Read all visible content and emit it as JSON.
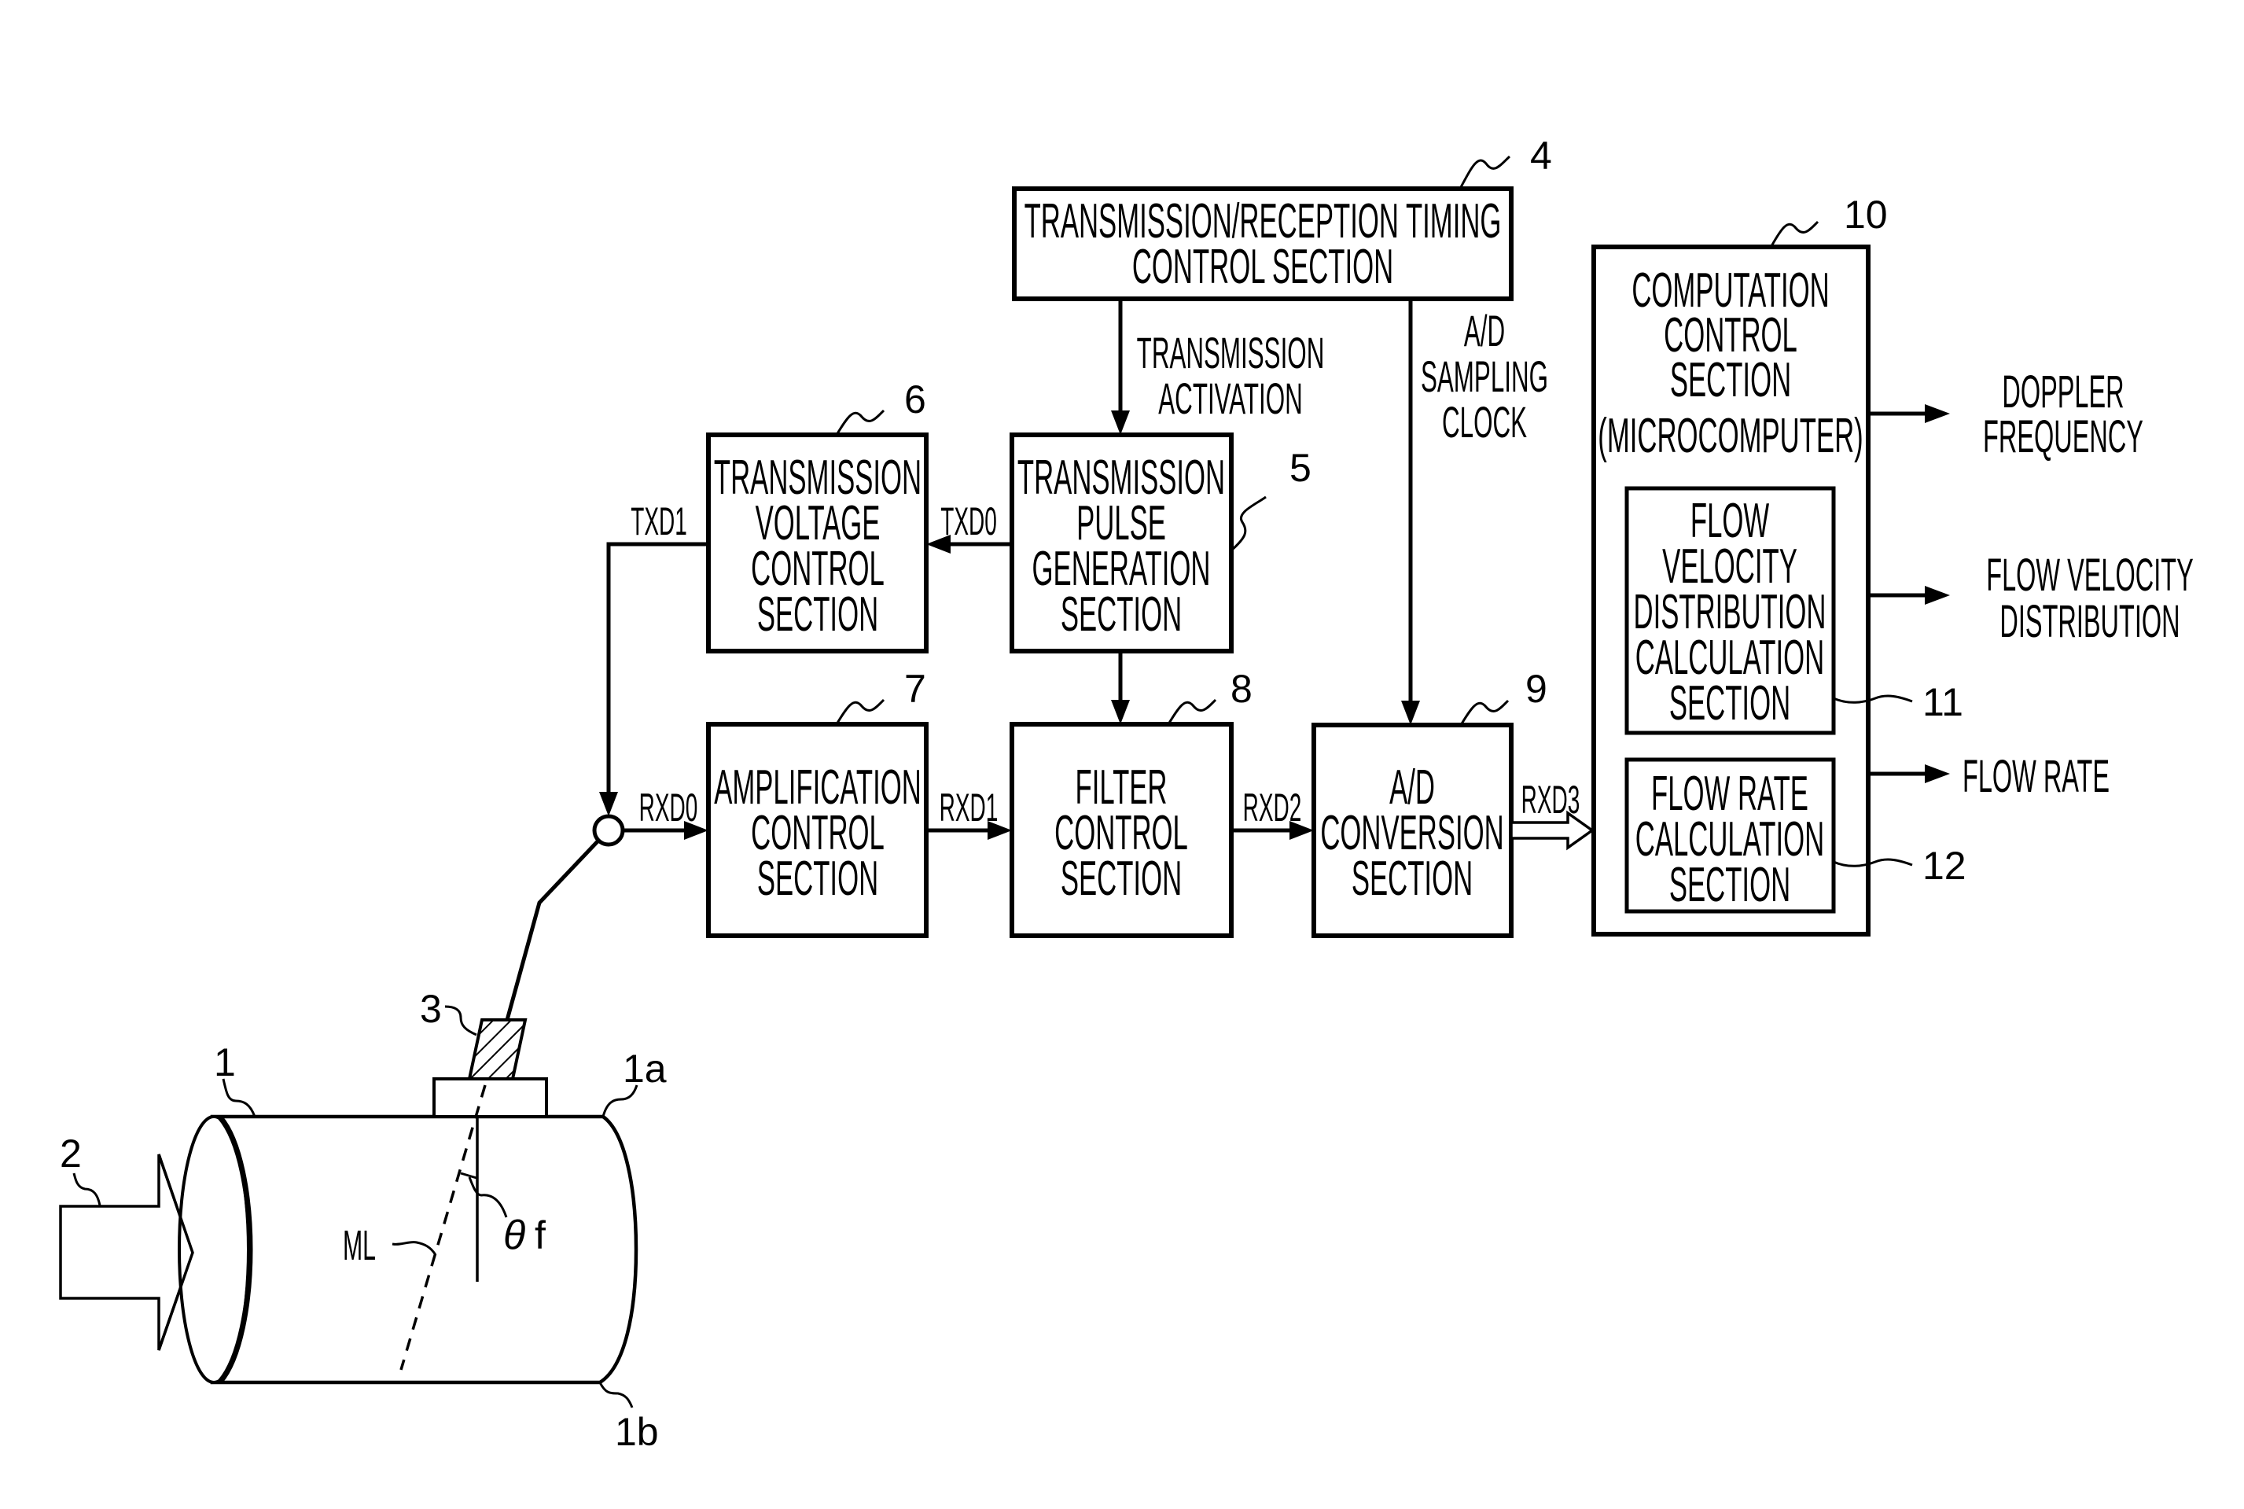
{
  "figure": {
    "blocks": {
      "timing": {
        "ref": "4",
        "lines": [
          "TRANSMISSION/RECEPTION TIMING",
          "CONTROL SECTION"
        ]
      },
      "pulse": {
        "ref": "5",
        "lines": [
          "TRANSMISSION",
          "PULSE",
          "GENERATION",
          "SECTION"
        ]
      },
      "voltage": {
        "ref": "6",
        "lines": [
          "TRANSMISSION",
          "VOLTAGE",
          "CONTROL",
          "SECTION"
        ]
      },
      "amplification": {
        "ref": "7",
        "lines": [
          "AMPLIFICATION",
          "CONTROL",
          "SECTION"
        ]
      },
      "filter": {
        "ref": "8",
        "lines": [
          "FILTER",
          "CONTROL",
          "SECTION"
        ]
      },
      "ad": {
        "ref": "9",
        "lines": [
          "A/D",
          "CONVERSION",
          "SECTION"
        ]
      },
      "computation": {
        "ref": "10",
        "lines": [
          "COMPUTATION",
          "CONTROL",
          "SECTION",
          "(MICROCOMPUTER)"
        ]
      },
      "velocity_calc": {
        "ref": "11",
        "lines": [
          "FLOW",
          "VELOCITY",
          "DISTRIBUTION",
          "CALCULATION",
          "SECTION"
        ]
      },
      "rate_calc": {
        "ref": "12",
        "lines": [
          "FLOW RATE",
          "CALCULATION",
          "SECTION"
        ]
      }
    },
    "signals": {
      "transmission_activation": [
        "TRANSMISSION",
        "ACTIVATION"
      ],
      "ad_sampling_clock": [
        "A/D",
        "SAMPLING",
        "CLOCK"
      ],
      "txd0": "TXD0",
      "txd1": "TXD1",
      "rxd0": "RXD0",
      "rxd1": "RXD1",
      "rxd2": "RXD2",
      "rxd3": "RXD3"
    },
    "outputs": {
      "doppler": [
        "DOPPLER",
        "FREQUENCY"
      ],
      "velocity": [
        "FLOW VELOCITY",
        "DISTRIBUTION"
      ],
      "rate": [
        "FLOW RATE"
      ]
    },
    "pipe": {
      "pipe_ref": "1",
      "upper_wall_ref": "1a",
      "lower_wall_ref": "1b",
      "flow_ref": "2",
      "transducer_ref": "3",
      "measurement_line": "ML",
      "angle_symbol": "θ",
      "angle_subscript": "f"
    }
  }
}
